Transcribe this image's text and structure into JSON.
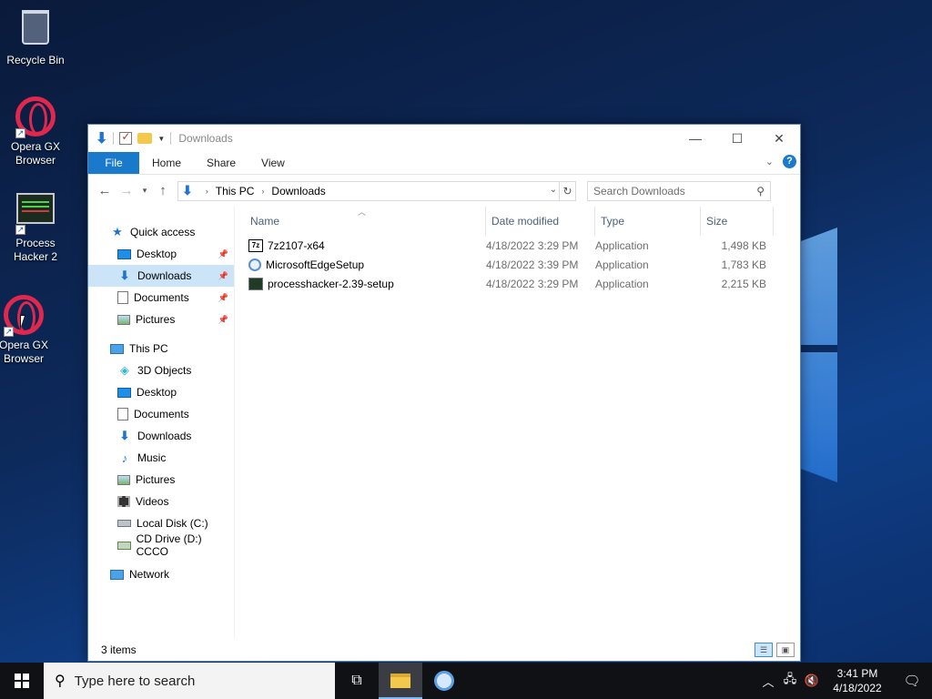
{
  "desktop": {
    "icons": [
      {
        "label": "Recycle Bin"
      },
      {
        "label": "Opera GX Browser"
      },
      {
        "label": "Process Hacker 2"
      },
      {
        "label": "Opera GX Browser"
      }
    ]
  },
  "window": {
    "title": "Downloads",
    "controls": {
      "minimize": "—",
      "maximize": "☐",
      "close": "✕"
    },
    "ribbon": {
      "tabs": [
        "File",
        "Home",
        "Share",
        "View"
      ]
    },
    "address": {
      "crumbs": [
        "This PC",
        "Downloads"
      ]
    },
    "search": {
      "placeholder": "Search Downloads"
    },
    "nav": {
      "quick_access": "Quick access",
      "quick_items": [
        "Desktop",
        "Downloads",
        "Documents",
        "Pictures"
      ],
      "this_pc": "This PC",
      "pc_items": [
        "3D Objects",
        "Desktop",
        "Documents",
        "Downloads",
        "Music",
        "Pictures",
        "Videos",
        "Local Disk (C:)",
        "CD Drive (D:) CCCO"
      ],
      "network": "Network"
    },
    "columns": {
      "name": "Name",
      "date": "Date modified",
      "type": "Type",
      "size": "Size"
    },
    "files": [
      {
        "name": "7z2107-x64",
        "date": "4/18/2022 3:29 PM",
        "type": "Application",
        "size": "1,498 KB",
        "icon": "7z-icon"
      },
      {
        "name": "MicrosoftEdgeSetup",
        "date": "4/18/2022 3:39 PM",
        "type": "Application",
        "size": "1,783 KB",
        "icon": "edge-setup-icon"
      },
      {
        "name": "processhacker-2.39-setup",
        "date": "4/18/2022 3:29 PM",
        "type": "Application",
        "size": "2,215 KB",
        "icon": "process-hacker-icon"
      }
    ],
    "status": {
      "items": "3 items"
    }
  },
  "taskbar": {
    "search_placeholder": "Type here to search",
    "time": "3:41 PM",
    "date": "4/18/2022"
  },
  "colors": {
    "accent": "#1979ca",
    "selection": "#cce4f7",
    "taskbar": "#101114"
  }
}
